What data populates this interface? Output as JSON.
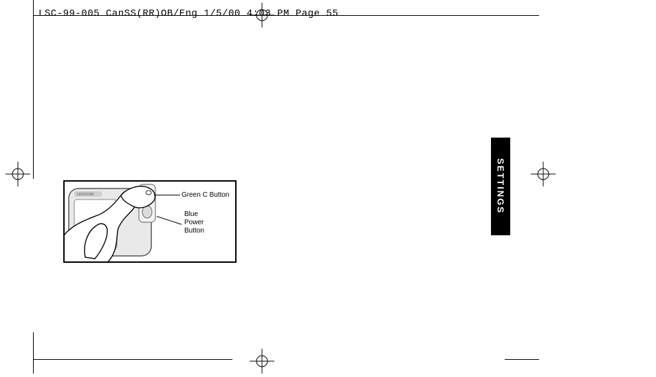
{
  "header": {
    "slug": "LSC-99-005 CanSS(RR)OB/Eng  1/5/00 4:03 PM  Page 55"
  },
  "tab": {
    "label": "SETTINGS"
  },
  "figure": {
    "device_brand": "LIFESCAN",
    "labels": {
      "green_c": "Green C Button",
      "blue_power_1": "Blue",
      "blue_power_2": "Power",
      "blue_power_3": "Button"
    }
  }
}
